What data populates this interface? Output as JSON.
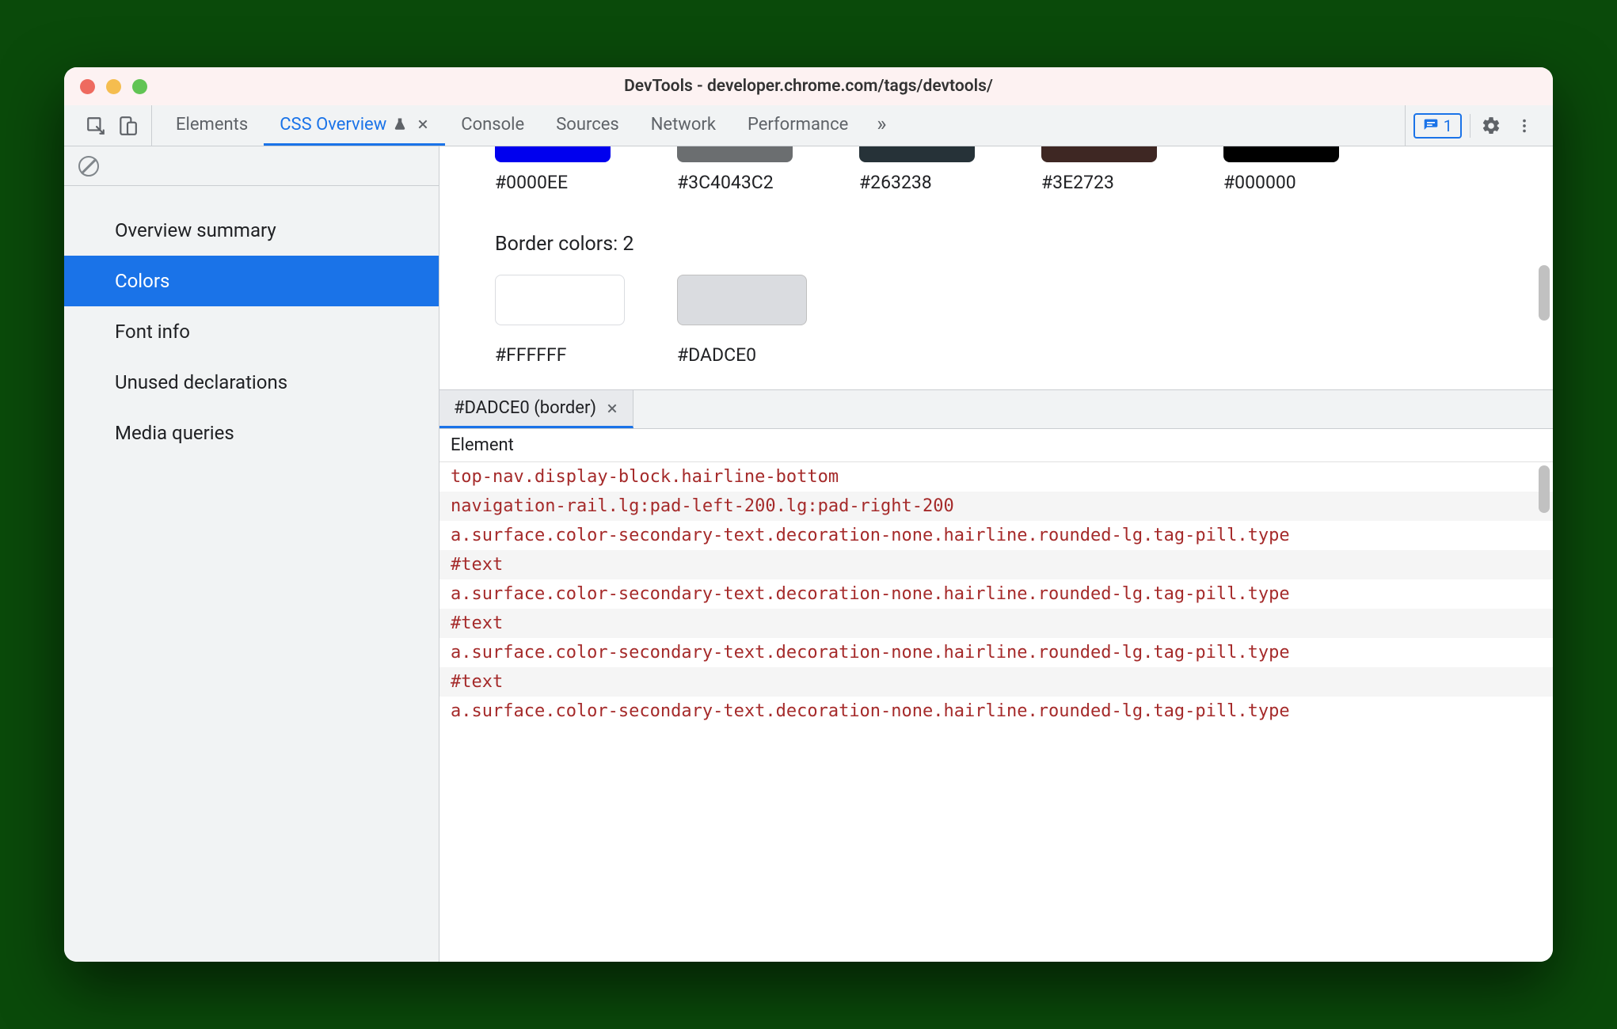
{
  "window": {
    "title": "DevTools - developer.chrome.com/tags/devtools/"
  },
  "toolbar": {
    "tabs": [
      {
        "label": "Elements",
        "active": false
      },
      {
        "label": "CSS Overview",
        "active": true,
        "experimental": true,
        "closable": true
      },
      {
        "label": "Console",
        "active": false
      },
      {
        "label": "Sources",
        "active": false
      },
      {
        "label": "Network",
        "active": false
      },
      {
        "label": "Performance",
        "active": false
      }
    ],
    "more_tabs_glyph": "»",
    "issues_count": "1"
  },
  "sidebar": {
    "items": [
      {
        "label": "Overview summary",
        "selected": false
      },
      {
        "label": "Colors",
        "selected": true
      },
      {
        "label": "Font info",
        "selected": false
      },
      {
        "label": "Unused declarations",
        "selected": false
      },
      {
        "label": "Media queries",
        "selected": false
      }
    ]
  },
  "colors_top_row": [
    {
      "hex": "#0000EE",
      "label": "#0000EE"
    },
    {
      "hex": "#3C4043",
      "alpha": "C2",
      "label": "#3C4043C2"
    },
    {
      "hex": "#263238",
      "label": "#263238"
    },
    {
      "hex": "#3E2723",
      "label": "#3E2723"
    },
    {
      "hex": "#000000",
      "label": "#000000"
    }
  ],
  "border_section": {
    "title": "Border colors: 2",
    "swatches": [
      {
        "hex": "#FFFFFF",
        "label": "#FFFFFF",
        "outline": true
      },
      {
        "hex": "#DADCE0",
        "label": "#DADCE0",
        "outline": true
      }
    ]
  },
  "details": {
    "tab_label": "#DADCE0 (border)",
    "header": "Element",
    "rows": [
      "top-nav.display-block.hairline-bottom",
      "navigation-rail.lg:pad-left-200.lg:pad-right-200",
      "a.surface.color-secondary-text.decoration-none.hairline.rounded-lg.tag-pill.type",
      "#text",
      "a.surface.color-secondary-text.decoration-none.hairline.rounded-lg.tag-pill.type",
      "#text",
      "a.surface.color-secondary-text.decoration-none.hairline.rounded-lg.tag-pill.type",
      "#text",
      "a.surface.color-secondary-text.decoration-none.hairline.rounded-lg.tag-pill.type"
    ]
  }
}
